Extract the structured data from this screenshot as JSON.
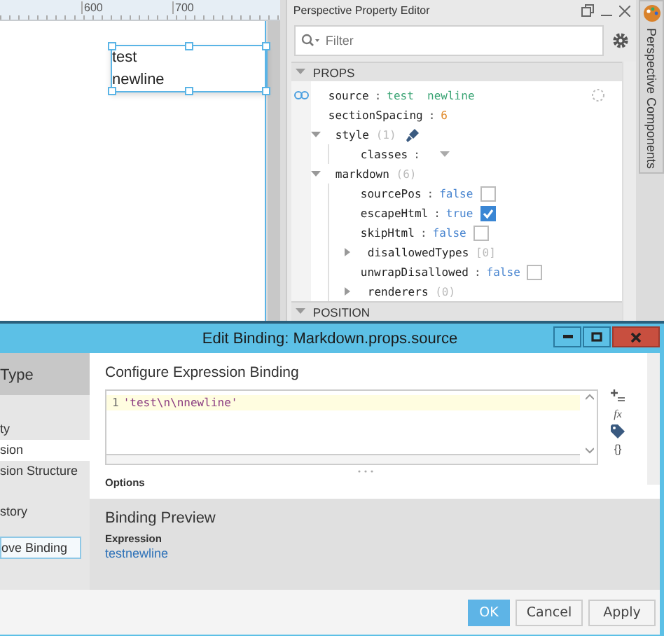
{
  "designer": {
    "ruler_labels": [
      "600",
      "700"
    ],
    "component_lines": [
      "test",
      "newline"
    ]
  },
  "property_editor": {
    "title": "Perspective Property Editor",
    "filter": {
      "placeholder": "Filter"
    },
    "sections": [
      {
        "title": "PROPS",
        "expanded": true,
        "items": [
          {
            "kind": "string",
            "key": "source",
            "sep": ":",
            "value": "test  newline",
            "bound": true
          },
          {
            "kind": "number",
            "key": "sectionSpacing",
            "sep": ":",
            "value": "6"
          },
          {
            "kind": "group",
            "key": "style",
            "count": "(1)",
            "expanded": true,
            "style_icon": true,
            "children": [
              {
                "kind": "dropdown",
                "key": "classes",
                "sep": ":"
              }
            ]
          },
          {
            "kind": "group",
            "key": "markdown",
            "count": "(6)",
            "expanded": true,
            "children": [
              {
                "kind": "bool",
                "key": "sourcePos",
                "sep": ":",
                "value": "false",
                "checked": false
              },
              {
                "kind": "bool",
                "key": "escapeHtml",
                "sep": ":",
                "value": "true",
                "checked": true
              },
              {
                "kind": "bool",
                "key": "skipHtml",
                "sep": ":",
                "value": "false",
                "checked": false
              },
              {
                "kind": "group",
                "key": "disallowedTypes",
                "count": "[0]",
                "expanded": false
              },
              {
                "kind": "bool",
                "key": "unwrapDisallowed",
                "sep": ":",
                "value": "false",
                "checked": false
              },
              {
                "kind": "group",
                "key": "renderers",
                "count": "(0)",
                "expanded": false
              }
            ]
          }
        ]
      },
      {
        "title": "POSITION",
        "expanded": true
      }
    ]
  },
  "side_tab": {
    "label": "Perspective Components"
  },
  "dialog": {
    "title": "Edit Binding: Markdown.props.source",
    "nav_header": "Type",
    "nav_items": [
      {
        "label": "ty",
        "selected": false
      },
      {
        "label": "sion",
        "selected": true
      },
      {
        "label": "sion Structure",
        "selected": false
      },
      {
        "label": "story",
        "selected": false
      }
    ],
    "remove_button": "ove Binding",
    "heading": "Configure Expression Binding",
    "code_lines": [
      {
        "number": "1",
        "text": "'test\\n\\nnewline'"
      }
    ],
    "tools": [
      "fx",
      "{}"
    ],
    "options_label": "Options",
    "preview_heading": "Binding Preview",
    "preview_label": "Expression",
    "preview_value": "testnewline",
    "buttons": [
      {
        "label": "OK",
        "primary": true
      },
      {
        "label": "Cancel",
        "primary": false
      },
      {
        "label": "Apply",
        "primary": false
      }
    ]
  }
}
